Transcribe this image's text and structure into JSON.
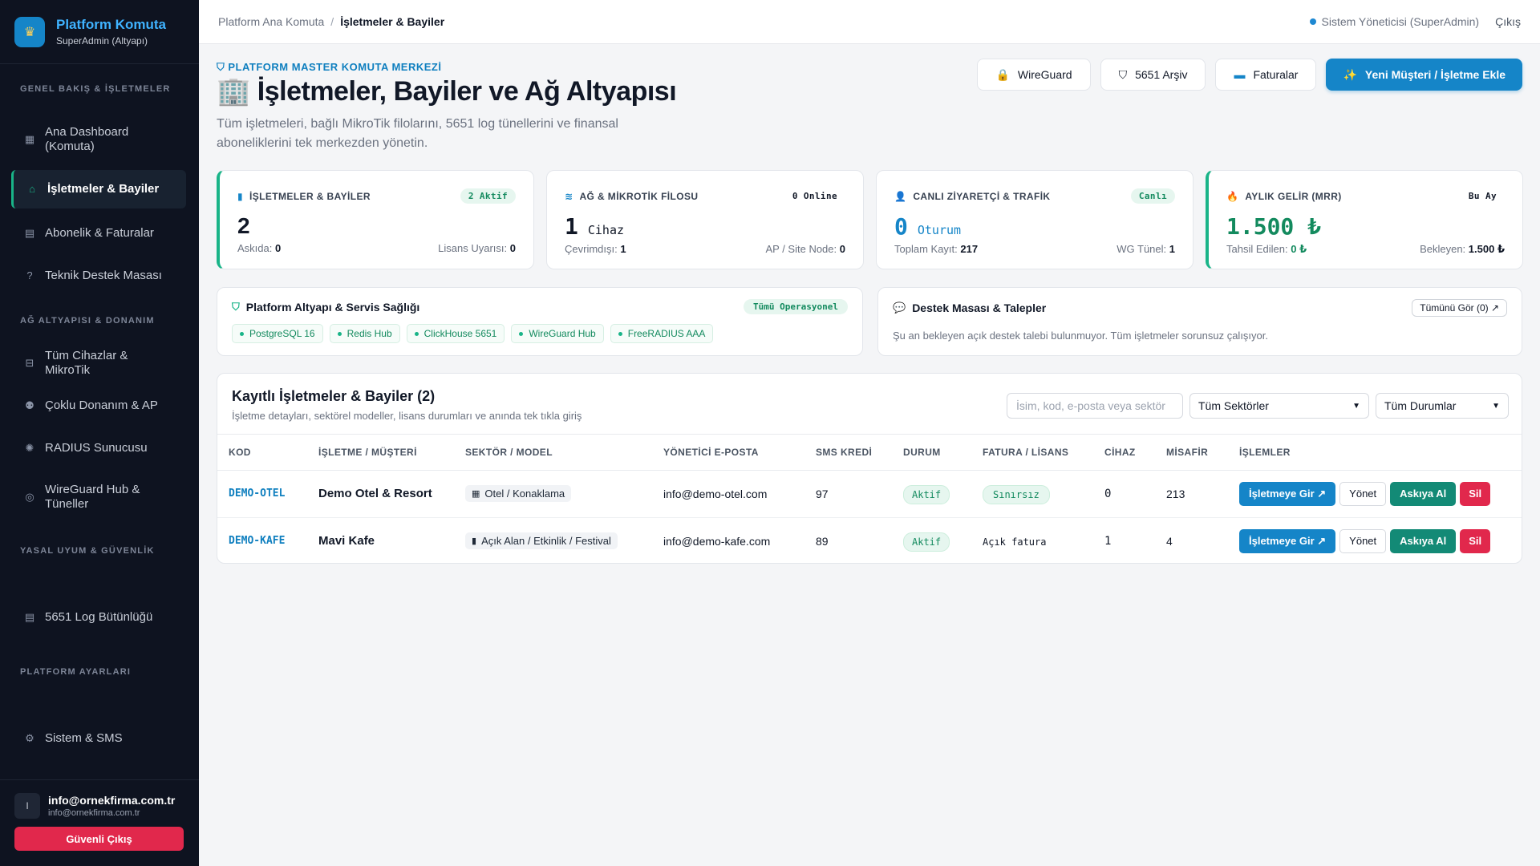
{
  "brand": {
    "logo_icon": "crown-icon",
    "title": "Platform Komuta",
    "subtitle": "SuperAdmin (Altyapı)"
  },
  "sidebar": {
    "sections": [
      {
        "label": "GENEL BAKIŞ & İŞLETMELER"
      },
      {
        "label": "AĞ ALTYAPISI & DONANIM"
      },
      {
        "label": "YASAL UYUM & GÜVENLİK"
      },
      {
        "label": "PLATFORM AYARLARI"
      }
    ],
    "items": [
      {
        "label": "Ana Dashboard (Komuta)",
        "icon": "grid-icon"
      },
      {
        "label": "İşletmeler & Bayiler",
        "icon": "store-icon",
        "active": true
      },
      {
        "label": "Abonelik & Faturalar",
        "icon": "document-icon"
      },
      {
        "label": "Teknik Destek Masası",
        "icon": "help-icon"
      },
      {
        "label": "Tüm Cihazlar & MikroTik",
        "icon": "router-icon"
      },
      {
        "label": "Çoklu Donanım & AP",
        "icon": "access-point-icon"
      },
      {
        "label": "RADIUS Sunucusu",
        "icon": "radius-icon"
      },
      {
        "label": "WireGuard Hub & Tüneller",
        "icon": "shield-icon"
      },
      {
        "label": "5651 Log Bütünlüğü",
        "icon": "log-icon"
      },
      {
        "label": "Sistem & SMS",
        "icon": "gear-icon"
      }
    ]
  },
  "user": {
    "initial": "I",
    "email": "info@ornekfirma.com.tr",
    "email_sub": "info@ornekfirma.com.tr",
    "logout_label": "Güvenli Çıkış"
  },
  "topbar": {
    "crumb_root": "Platform Ana Komuta",
    "crumb_sep": "/",
    "crumb_current": "İşletmeler & Bayiler",
    "role": "Sistem Yöneticisi (SuperAdmin)",
    "logout": "Çıkış"
  },
  "header": {
    "kicker": "PLATFORM MASTER KOMUTA MERKEZİ",
    "title": "İşletmeler, Bayiler ve Ağ Altyapısı",
    "title_icon": "🏢",
    "description": "Tüm işletmeleri, bağlı MikroTik filolarını, 5651 log tünellerini ve finansal aboneliklerini tek merkezden yönetin.",
    "actions": [
      {
        "label": "WireGuard",
        "icon": "lock-icon"
      },
      {
        "label": "5651 Arşiv",
        "icon": "shield-icon"
      },
      {
        "label": "Faturalar",
        "icon": "card-icon"
      },
      {
        "label": "Yeni Müşteri / İşletme Ekle",
        "icon": "sparkle-icon",
        "primary": true
      }
    ]
  },
  "stats": [
    {
      "title": "İŞLETMELER & BAYİLER",
      "icon": "building-icon",
      "badge": "2 Aktif",
      "value": "2",
      "unit": "",
      "foot_left_label": "Askıda:",
      "foot_left_value": "0",
      "foot_right_label": "Lisans Uyarısı:",
      "foot_right_value": "0",
      "accent": "#19b488",
      "value_color": "#111827"
    },
    {
      "title": "AĞ & MİKROTİK FİLOSU",
      "icon": "wifi-icon",
      "badge": "0 Online",
      "value": "1",
      "unit": "Cihaz",
      "foot_left_label": "Çevrimdışı:",
      "foot_left_value": "1",
      "foot_right_label": "AP / Site Node:",
      "foot_right_value": "0",
      "accent": "",
      "value_color": "#111827"
    },
    {
      "title": "CANLI ZİYARETÇİ & TRAFİK",
      "icon": "users-icon",
      "badge": "Canlı",
      "value": "0",
      "unit": "Oturum",
      "foot_left_label": "Toplam Kayıt:",
      "foot_left_value": "217",
      "foot_right_label": "WG Tünel:",
      "foot_right_value": "1",
      "accent": "",
      "value_color": "#1585c8"
    },
    {
      "title": "AYLIK GELİR (MRR)",
      "icon": "fire-icon",
      "badge": "Bu Ay",
      "value": "1.500 ₺",
      "unit": "",
      "foot_left_label": "Tahsil Edilen:",
      "foot_left_value": "0 ₺",
      "foot_right_label": "Bekleyen:",
      "foot_right_value": "1.500 ₺",
      "accent": "#19b488",
      "value_color": "#138a5e"
    }
  ],
  "infra": {
    "title": "Platform Altyapı & Servis Sağlığı",
    "status": "Tümü Operasyonel",
    "services": [
      "PostgreSQL 16",
      "Redis Hub",
      "ClickHouse 5651",
      "WireGuard Hub",
      "FreeRADIUS AAA"
    ]
  },
  "support": {
    "title": "Destek Masası & Talepler",
    "view_all": "Tümünü Gör (0) ↗",
    "message": "Şu an bekleyen açık destek talebi bulunmuyor. Tüm işletmeler sorunsuz çalışıyor."
  },
  "table": {
    "title": "Kayıtlı İşletmeler & Bayiler (2)",
    "subtitle": "İşletme detayları, sektörel modeller, lisans durumları ve anında tek tıkla giriş",
    "search_placeholder": "İsim, kod, e-posta veya sektör",
    "sector_filter": "Tüm Sektörler",
    "status_filter": "Tüm Durumlar",
    "columns": [
      "KOD",
      "İŞLETME / MÜŞTERİ",
      "SEKTÖR / MODEL",
      "YÖNETİCİ E-POSTA",
      "SMS KREDİ",
      "DURUM",
      "FATURA / LİSANS",
      "CİHAZ",
      "MİSAFİR",
      "İŞLEMLER"
    ],
    "rows": [
      {
        "code": "DEMO-OTEL",
        "name": "Demo Otel & Resort",
        "sector": "Otel / Konaklama",
        "email": "info@demo-otel.com",
        "sms": "97",
        "status": "Aktif",
        "license": "Sınırsız",
        "license_badge": true,
        "devices": "0",
        "guests": "213"
      },
      {
        "code": "DEMO-KAFE",
        "name": "Mavi Kafe",
        "sector": "Açık Alan / Etkinlik / Festival",
        "email": "info@demo-kafe.com",
        "sms": "89",
        "status": "Aktif",
        "license": "Açık fatura",
        "license_badge": false,
        "devices": "1",
        "guests": "4"
      }
    ],
    "actions": {
      "enter": "İşletmeye Gir ↗",
      "manage": "Yönet",
      "suspend": "Askıya Al",
      "delete": "Sil"
    }
  }
}
